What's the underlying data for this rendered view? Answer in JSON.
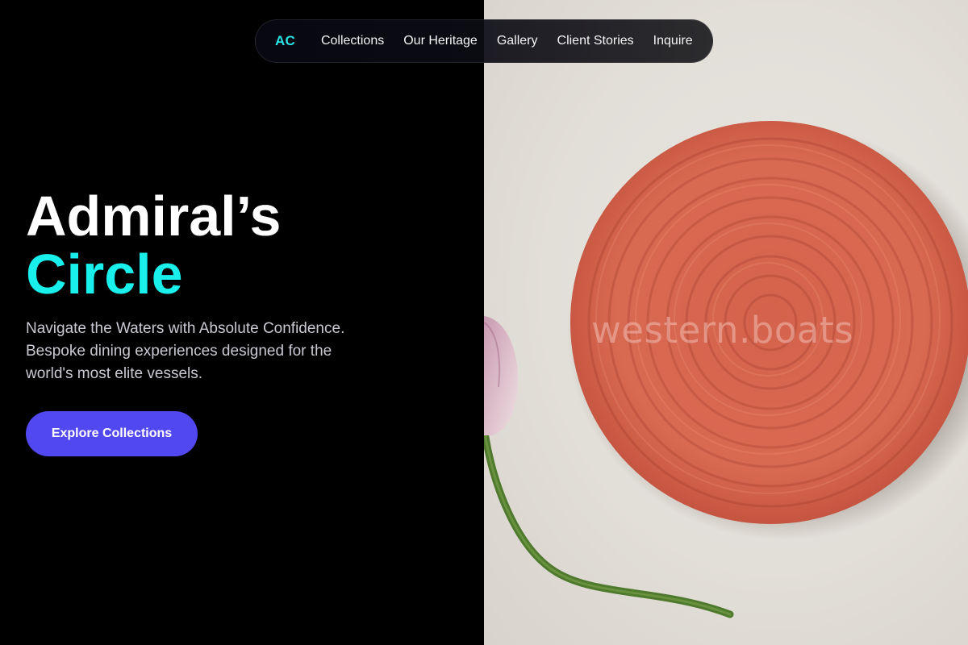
{
  "nav": {
    "logo": "AC",
    "links": [
      "Collections",
      "Our Heritage",
      "Gallery",
      "Client Stories",
      "Inquire"
    ]
  },
  "hero": {
    "title_line1": "Admiral’s",
    "title_line2": "Circle",
    "subtitle": "Navigate the Waters with Absolute Confidence. Bespoke dining experiences designed for the world's most elite vessels.",
    "cta_label": "Explore Collections"
  },
  "image": {
    "watermark": "western.boats"
  },
  "colors": {
    "background": "#000000",
    "accent_cyan": "#19f0ec",
    "cta_purple": "#5248f2",
    "plate": "#d9674f"
  }
}
